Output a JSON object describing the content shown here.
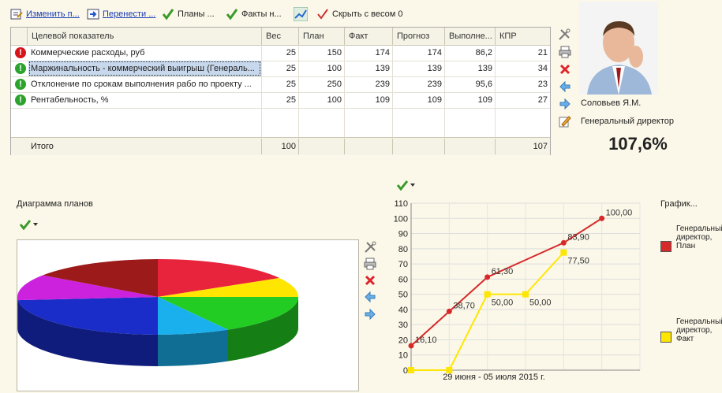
{
  "toolbar": {
    "edit_label": "Изменить п...",
    "move_label": "Перенести ...",
    "plans_label": "Планы ...",
    "facts_label": "Факты н...",
    "hide_label": "Скрыть с весом 0"
  },
  "grid": {
    "columns": [
      "Целевой показатель",
      "Вес",
      "План",
      "Факт",
      "Прогноз",
      "Выполне...",
      "КПР"
    ],
    "rows": [
      {
        "status": "red",
        "status_glyph": "!",
        "name": "Коммерческие расходы, руб",
        "weight": "25",
        "plan": "150",
        "fact": "174",
        "forecast": "174",
        "done": "86,2",
        "kpr": "21"
      },
      {
        "status": "green",
        "status_glyph": "!",
        "name": "Маржинальность - коммерческий выигрыш (Генераль...",
        "weight": "25",
        "plan": "100",
        "fact": "139",
        "forecast": "139",
        "done": "139",
        "kpr": "34"
      },
      {
        "status": "green",
        "status_glyph": "!",
        "name": "Отклонение по срокам выполнения рабо  по проекту ...",
        "weight": "25",
        "plan": "250",
        "fact": "239",
        "forecast": "239",
        "done": "95,6",
        "kpr": "23"
      },
      {
        "status": "green",
        "status_glyph": "!",
        "name": "Рентабельность, %",
        "weight": "25",
        "plan": "100",
        "fact": "109",
        "forecast": "109",
        "done": "109",
        "kpr": "27"
      }
    ],
    "footer": {
      "label": "Итого",
      "weight": "100",
      "kpr": "107"
    }
  },
  "manager": {
    "name": "Соловьев Я.М.",
    "title": "Генеральный директор",
    "percent": "107,6%"
  },
  "pie": {
    "title": "Диаграмма планов",
    "colors": [
      "#e8243c",
      "#ffe600",
      "#22cc22",
      "#1ab0ee",
      "#1a2dc8",
      "#cc22dd",
      "#9c1a1a"
    ]
  },
  "line_chart": {
    "title": "График...",
    "date_label": "29 июня - 05 июля 2015 г.",
    "y_ticks": [
      "0",
      "10",
      "20",
      "30",
      "40",
      "50",
      "60",
      "70",
      "80",
      "90",
      "100",
      "110"
    ],
    "colors": {
      "plan": "#d62a2a",
      "fact": "#ffe600"
    }
  },
  "chart_data": {
    "type": "line",
    "x": [
      0,
      1,
      2,
      3,
      4,
      5,
      6
    ],
    "ylim": [
      0,
      110
    ],
    "series": [
      {
        "name": "Генеральный директор, План",
        "values": [
          16.1,
          38.7,
          61.3,
          null,
          83.9,
          100.0,
          null
        ],
        "labels": [
          "16,10",
          "38,70",
          "61,30",
          "",
          "83,90",
          "100,00",
          ""
        ]
      },
      {
        "name": "Генеральный директор, Факт",
        "values": [
          0,
          0,
          50.0,
          50.0,
          77.5,
          null,
          null
        ],
        "labels": [
          "",
          "",
          "50,00",
          "50,00",
          "77,50",
          "",
          ""
        ]
      }
    ],
    "legend": "right"
  }
}
